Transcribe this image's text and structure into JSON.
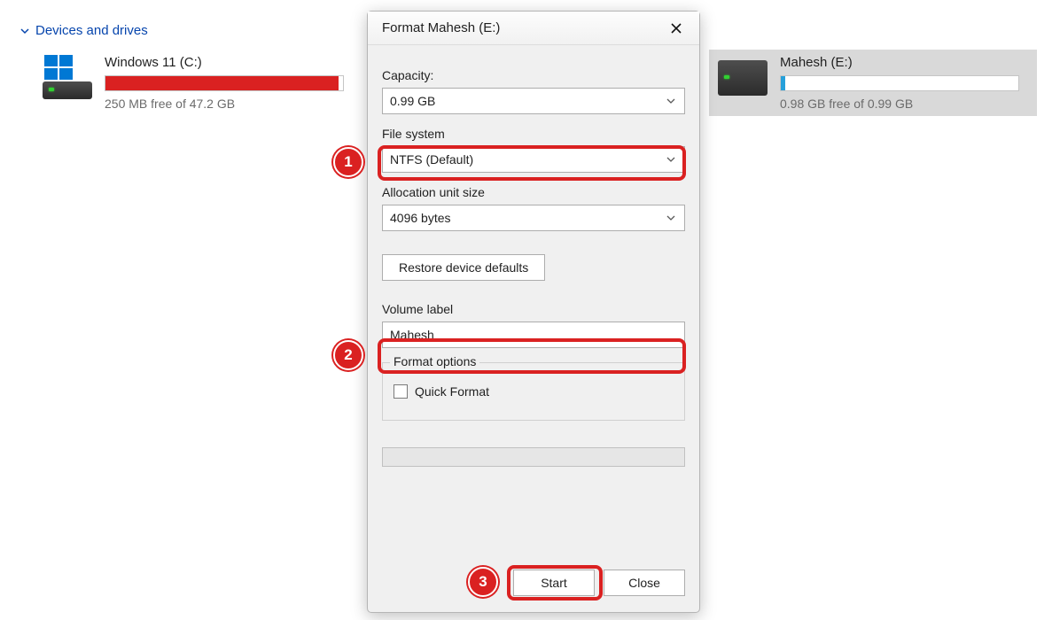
{
  "section_title": "Devices and drives",
  "drives": {
    "c": {
      "name": "Windows 11 (C:)",
      "free_text": "250 MB free of 47.2 GB",
      "fill_percent": 98
    },
    "e": {
      "name": "Mahesh (E:)",
      "free_text": "0.98 GB free of 0.99 GB",
      "fill_percent": 2
    }
  },
  "dialog": {
    "title": "Format Mahesh (E:)",
    "capacity_label": "Capacity:",
    "capacity_value": "0.99 GB",
    "filesystem_label": "File system",
    "filesystem_value": "NTFS (Default)",
    "allocation_label": "Allocation unit size",
    "allocation_value": "4096 bytes",
    "restore_label": "Restore device defaults",
    "volume_label_label": "Volume label",
    "volume_label_value": "Mahesh",
    "format_options_label": "Format options",
    "quick_format_label": "Quick Format",
    "start_label": "Start",
    "close_label": "Close"
  },
  "annotations": {
    "n1": "1",
    "n2": "2",
    "n3": "3"
  }
}
